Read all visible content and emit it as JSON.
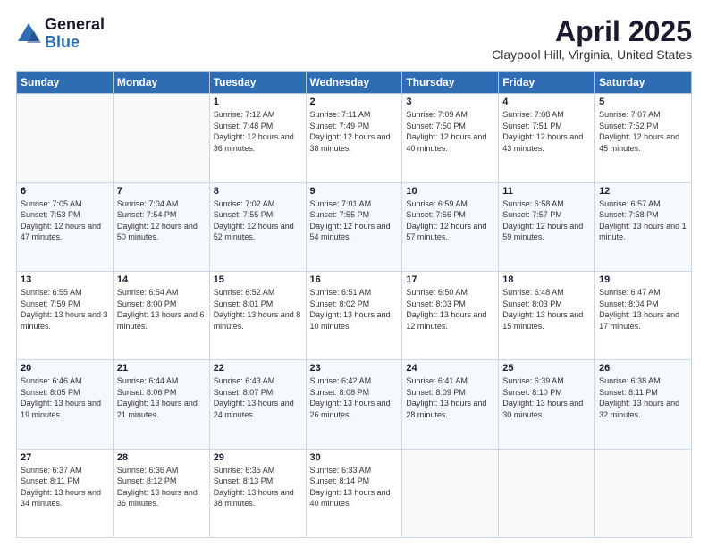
{
  "logo": {
    "general": "General",
    "blue": "Blue"
  },
  "title": "April 2025",
  "subtitle": "Claypool Hill, Virginia, United States",
  "days_of_week": [
    "Sunday",
    "Monday",
    "Tuesday",
    "Wednesday",
    "Thursday",
    "Friday",
    "Saturday"
  ],
  "weeks": [
    [
      {
        "day": "",
        "info": ""
      },
      {
        "day": "",
        "info": ""
      },
      {
        "day": "1",
        "info": "Sunrise: 7:12 AM\nSunset: 7:48 PM\nDaylight: 12 hours and 36 minutes."
      },
      {
        "day": "2",
        "info": "Sunrise: 7:11 AM\nSunset: 7:49 PM\nDaylight: 12 hours and 38 minutes."
      },
      {
        "day": "3",
        "info": "Sunrise: 7:09 AM\nSunset: 7:50 PM\nDaylight: 12 hours and 40 minutes."
      },
      {
        "day": "4",
        "info": "Sunrise: 7:08 AM\nSunset: 7:51 PM\nDaylight: 12 hours and 43 minutes."
      },
      {
        "day": "5",
        "info": "Sunrise: 7:07 AM\nSunset: 7:52 PM\nDaylight: 12 hours and 45 minutes."
      }
    ],
    [
      {
        "day": "6",
        "info": "Sunrise: 7:05 AM\nSunset: 7:53 PM\nDaylight: 12 hours and 47 minutes."
      },
      {
        "day": "7",
        "info": "Sunrise: 7:04 AM\nSunset: 7:54 PM\nDaylight: 12 hours and 50 minutes."
      },
      {
        "day": "8",
        "info": "Sunrise: 7:02 AM\nSunset: 7:55 PM\nDaylight: 12 hours and 52 minutes."
      },
      {
        "day": "9",
        "info": "Sunrise: 7:01 AM\nSunset: 7:55 PM\nDaylight: 12 hours and 54 minutes."
      },
      {
        "day": "10",
        "info": "Sunrise: 6:59 AM\nSunset: 7:56 PM\nDaylight: 12 hours and 57 minutes."
      },
      {
        "day": "11",
        "info": "Sunrise: 6:58 AM\nSunset: 7:57 PM\nDaylight: 12 hours and 59 minutes."
      },
      {
        "day": "12",
        "info": "Sunrise: 6:57 AM\nSunset: 7:58 PM\nDaylight: 13 hours and 1 minute."
      }
    ],
    [
      {
        "day": "13",
        "info": "Sunrise: 6:55 AM\nSunset: 7:59 PM\nDaylight: 13 hours and 3 minutes."
      },
      {
        "day": "14",
        "info": "Sunrise: 6:54 AM\nSunset: 8:00 PM\nDaylight: 13 hours and 6 minutes."
      },
      {
        "day": "15",
        "info": "Sunrise: 6:52 AM\nSunset: 8:01 PM\nDaylight: 13 hours and 8 minutes."
      },
      {
        "day": "16",
        "info": "Sunrise: 6:51 AM\nSunset: 8:02 PM\nDaylight: 13 hours and 10 minutes."
      },
      {
        "day": "17",
        "info": "Sunrise: 6:50 AM\nSunset: 8:03 PM\nDaylight: 13 hours and 12 minutes."
      },
      {
        "day": "18",
        "info": "Sunrise: 6:48 AM\nSunset: 8:03 PM\nDaylight: 13 hours and 15 minutes."
      },
      {
        "day": "19",
        "info": "Sunrise: 6:47 AM\nSunset: 8:04 PM\nDaylight: 13 hours and 17 minutes."
      }
    ],
    [
      {
        "day": "20",
        "info": "Sunrise: 6:46 AM\nSunset: 8:05 PM\nDaylight: 13 hours and 19 minutes."
      },
      {
        "day": "21",
        "info": "Sunrise: 6:44 AM\nSunset: 8:06 PM\nDaylight: 13 hours and 21 minutes."
      },
      {
        "day": "22",
        "info": "Sunrise: 6:43 AM\nSunset: 8:07 PM\nDaylight: 13 hours and 24 minutes."
      },
      {
        "day": "23",
        "info": "Sunrise: 6:42 AM\nSunset: 8:08 PM\nDaylight: 13 hours and 26 minutes."
      },
      {
        "day": "24",
        "info": "Sunrise: 6:41 AM\nSunset: 8:09 PM\nDaylight: 13 hours and 28 minutes."
      },
      {
        "day": "25",
        "info": "Sunrise: 6:39 AM\nSunset: 8:10 PM\nDaylight: 13 hours and 30 minutes."
      },
      {
        "day": "26",
        "info": "Sunrise: 6:38 AM\nSunset: 8:11 PM\nDaylight: 13 hours and 32 minutes."
      }
    ],
    [
      {
        "day": "27",
        "info": "Sunrise: 6:37 AM\nSunset: 8:11 PM\nDaylight: 13 hours and 34 minutes."
      },
      {
        "day": "28",
        "info": "Sunrise: 6:36 AM\nSunset: 8:12 PM\nDaylight: 13 hours and 36 minutes."
      },
      {
        "day": "29",
        "info": "Sunrise: 6:35 AM\nSunset: 8:13 PM\nDaylight: 13 hours and 38 minutes."
      },
      {
        "day": "30",
        "info": "Sunrise: 6:33 AM\nSunset: 8:14 PM\nDaylight: 13 hours and 40 minutes."
      },
      {
        "day": "",
        "info": ""
      },
      {
        "day": "",
        "info": ""
      },
      {
        "day": "",
        "info": ""
      }
    ]
  ]
}
